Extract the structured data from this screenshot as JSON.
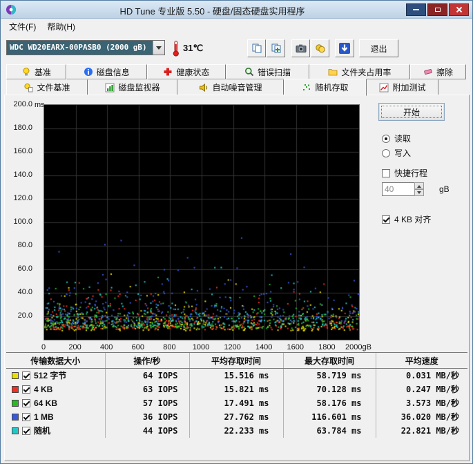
{
  "window": {
    "title": "HD Tune 专业版 5.50 - 硬盘/固态硬盘实用程序"
  },
  "menu": {
    "file": "文件(F)",
    "help": "帮助(H)"
  },
  "toolbar": {
    "drive": "WDC WD20EARX-00PASB0  (2000 gB)",
    "temperature": "31℃",
    "exit": "退出"
  },
  "tabs": {
    "row1": [
      {
        "label": "基准"
      },
      {
        "label": "磁盘信息"
      },
      {
        "label": "健康状态"
      },
      {
        "label": "错误扫描"
      },
      {
        "label": "文件夹占用率"
      },
      {
        "label": "擦除"
      }
    ],
    "row2": [
      {
        "label": "文件基准"
      },
      {
        "label": "磁盘监视器"
      },
      {
        "label": "自动噪音管理"
      },
      {
        "label": "随机存取"
      },
      {
        "label": "附加测试"
      }
    ],
    "active": "随机存取"
  },
  "controls": {
    "start": "开始",
    "read": "读取",
    "write": "写入",
    "read_selected": true,
    "short_stroke": "快捷行程",
    "short_stroke_checked": false,
    "short_stroke_value": "40",
    "short_stroke_unit": "gB",
    "align": "4 KB 对齐",
    "align_checked": true
  },
  "chart_data": {
    "type": "scatter",
    "ylabel_unit": "ms",
    "ymax": 200,
    "xmax": 2000,
    "y_ticks": [
      "200.0",
      "180.0",
      "160.0",
      "140.0",
      "120.0",
      "100.0",
      "80.0",
      "60.0",
      "40.0",
      "20.0"
    ],
    "x_ticks": [
      "0",
      "200",
      "400",
      "600",
      "800",
      "1000",
      "1200",
      "1400",
      "1600",
      "1800",
      "2000gB"
    ],
    "grid_on": true,
    "grid_color": "#333333",
    "bg_color": "#000000",
    "seed": 1337,
    "series": [
      {
        "name": "512 字节",
        "color": "#e8e000",
        "points": 280,
        "base": 7,
        "spread": 7,
        "max": 58.719
      },
      {
        "name": "4 KB",
        "color": "#f03020",
        "points": 280,
        "base": 8,
        "spread": 7.5,
        "max": 70.128
      },
      {
        "name": "64 KB",
        "color": "#28b828",
        "points": 270,
        "base": 9,
        "spread": 8,
        "max": 58.176
      },
      {
        "name": "1 MB",
        "color": "#3858d8",
        "points": 250,
        "base": 14,
        "spread": 11,
        "max": 116.601
      },
      {
        "name": "随机",
        "color": "#20c8c8",
        "points": 250,
        "base": 10,
        "spread": 9,
        "max": 63.784
      }
    ]
  },
  "table": {
    "headers": [
      "传输数据大小",
      "操作/秒",
      "平均存取时间",
      "最大存取时间",
      "平均速度"
    ],
    "rows": [
      {
        "color": "#e8e000",
        "label": "512 字节",
        "iops": "64 IOPS",
        "avg_time": "15.516 ms",
        "max_time": "58.719 ms",
        "speed": "0.031 MB/秒"
      },
      {
        "color": "#f03020",
        "label": "4 KB",
        "iops": "63 IOPS",
        "avg_time": "15.821 ms",
        "max_time": "70.128 ms",
        "speed": "0.247 MB/秒"
      },
      {
        "color": "#28b828",
        "label": "64 KB",
        "iops": "57 IOPS",
        "avg_time": "17.491 ms",
        "max_time": "58.176 ms",
        "speed": "3.573 MB/秒"
      },
      {
        "color": "#3858d8",
        "label": "1 MB",
        "iops": "36 IOPS",
        "avg_time": "27.762 ms",
        "max_time": "116.601 ms",
        "speed": "36.020 MB/秒"
      },
      {
        "color": "#20c8c8",
        "label": "随机",
        "iops": "44 IOPS",
        "avg_time": "22.233 ms",
        "max_time": "63.784 ms",
        "speed": "22.821 MB/秒"
      }
    ]
  }
}
